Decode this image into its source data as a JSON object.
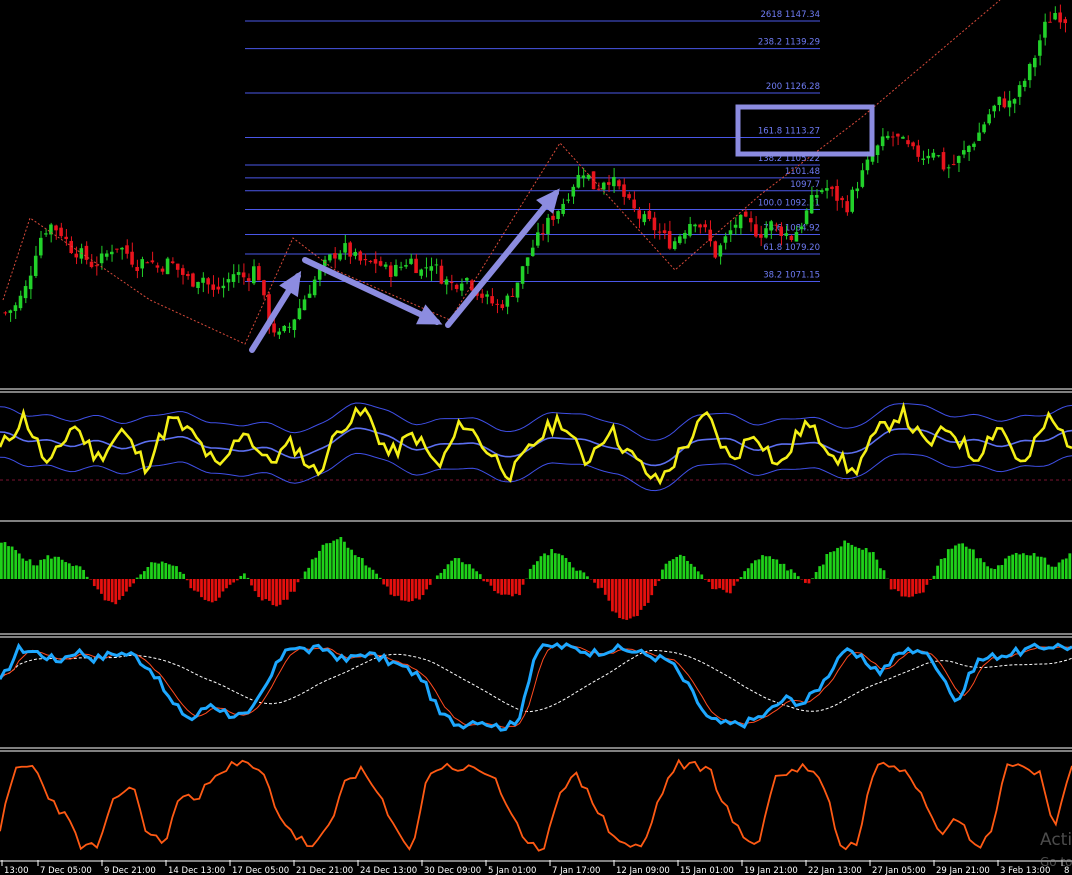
{
  "chart_data": [
    {
      "type": "candlestick",
      "symbol_context": "price with fibonacci retracement/extension levels",
      "fib_levels": [
        {
          "label": "2618 1147.34",
          "value": 1147.34
        },
        {
          "label": "238.2 1139.29",
          "value": 1139.29
        },
        {
          "label": "200 1126.28",
          "value": 1126.28
        },
        {
          "label": "161.8 1113.27",
          "value": 1113.27
        },
        {
          "label": "138.2 1105.22",
          "value": 1105.22
        },
        {
          "label": "1101.48",
          "value": 1101.48
        },
        {
          "label": "1097.7",
          "value": 1097.7
        },
        {
          "label": "100.0 1092.21",
          "value": 1092.21
        },
        {
          "label": "78.6 1084.92",
          "value": 1084.92
        },
        {
          "label": "61.8 1079.20",
          "value": 1079.2
        },
        {
          "label": "38.2 1071.15",
          "value": 1071.15
        }
      ],
      "close_trend": [
        1062,
        1064,
        1070,
        1083,
        1088,
        1086,
        1081,
        1079,
        1076,
        1078,
        1082,
        1080,
        1076,
        1078,
        1075,
        1077,
        1074,
        1071,
        1073,
        1068,
        1070,
        1074,
        1072,
        1076,
        1060,
        1055,
        1058,
        1064,
        1070,
        1075,
        1079,
        1081,
        1078,
        1076,
        1077,
        1074,
        1075,
        1078,
        1074,
        1077,
        1072,
        1070,
        1073,
        1069,
        1066,
        1064,
        1066,
        1072,
        1080,
        1085,
        1090,
        1094,
        1100,
        1104,
        1098,
        1102,
        1099,
        1094,
        1090,
        1088,
        1085,
        1082,
        1086,
        1090,
        1086,
        1079,
        1084,
        1089,
        1088,
        1085,
        1088,
        1086,
        1084,
        1089,
        1096,
        1099,
        1096,
        1093,
        1100,
        1106,
        1111,
        1114,
        1112,
        1109,
        1108,
        1110,
        1104,
        1106,
        1110,
        1114,
        1120,
        1124,
        1123,
        1128,
        1135,
        1145,
        1150,
        1148
      ]
    },
    {
      "type": "line",
      "name": "oscillator-1",
      "series": [
        {
          "values": [
            55,
            82,
            40,
            76,
            48,
            70,
            42,
            80,
            65,
            38,
            72,
            44,
            60,
            35,
            75,
            85,
            50,
            68,
            40,
            78,
            55,
            35,
            62,
            80,
            45,
            72,
            48,
            28,
            55,
            82,
            46,
            70,
            40,
            76,
            58,
            36,
            68,
            85,
            58,
            72,
            48,
            76,
            40,
            80,
            60
          ]
        }
      ]
    },
    {
      "type": "bar",
      "name": "histogram",
      "values": [
        0.8,
        0.6,
        0.3,
        0.5,
        0.4,
        0.2,
        -0.3,
        -0.6,
        -0.2,
        0.3,
        0.4,
        0.2,
        -0.3,
        -0.5,
        -0.2,
        0.1,
        -0.4,
        -0.6,
        -0.3,
        0.3,
        0.8,
        0.9,
        0.5,
        0.2,
        -0.3,
        -0.5,
        -0.4,
        0.1,
        0.5,
        0.3,
        -0.1,
        -0.4,
        -0.3,
        0.4,
        0.6,
        0.4,
        0.1,
        -0.2,
        -0.8,
        -0.9,
        -0.5,
        0.3,
        0.5,
        0.2,
        -0.2,
        -0.3,
        0.2,
        0.5,
        0.4,
        0.1,
        -0.1,
        0.5,
        0.8,
        0.7,
        0.5,
        -0.2,
        -0.4,
        -0.3,
        0.4,
        0.8,
        0.6,
        0.2,
        0.4,
        0.6,
        0.5,
        0.3,
        0.5
      ]
    },
    {
      "type": "line",
      "name": "stochastic",
      "series": [
        {
          "values": [
            60,
            92,
            88,
            80,
            90,
            82,
            88,
            86,
            70,
            40,
            25,
            40,
            30,
            28,
            60,
            95,
            90,
            92,
            80,
            88,
            82,
            75,
            65,
            30,
            20,
            25,
            18,
            20,
            90,
            95,
            92,
            88,
            92,
            90,
            85,
            80,
            55,
            25,
            20,
            22,
            30,
            45,
            40,
            60,
            90,
            82,
            70,
            88,
            92,
            75,
            40,
            80,
            85,
            88,
            92,
            95,
            93
          ]
        }
      ]
    },
    {
      "type": "line",
      "name": "oscillator-2",
      "series": [
        {
          "values": [
            30,
            88,
            90,
            60,
            40,
            10,
            12,
            60,
            72,
            22,
            15,
            65,
            55,
            85,
            90,
            92,
            80,
            40,
            20,
            10,
            30,
            80,
            85,
            60,
            25,
            10,
            85,
            90,
            88,
            86,
            80,
            40,
            10,
            12,
            70,
            80,
            55,
            25,
            12,
            10,
            60,
            92,
            90,
            88,
            50,
            20,
            15,
            80,
            85,
            90,
            70,
            10,
            15,
            90,
            92,
            88,
            60,
            25,
            45,
            10,
            20,
            92,
            90,
            85,
            30,
            88
          ]
        }
      ]
    }
  ],
  "time_axis": {
    "labels": [
      "13:00",
      "7 Dec 05:00",
      "9 Dec 21:00",
      "14 Dec 13:00",
      "17 Dec 05:00",
      "21 Dec 21:00",
      "24 Dec 13:00",
      "30 Dec 09:00",
      "5 Jan 01:00",
      "7 Jan 17:00",
      "12 Jan 09:00",
      "15 Jan 01:00",
      "19 Jan 21:00",
      "22 Jan 13:00",
      "27 Jan 05:00",
      "29 Jan 21:00",
      "3 Feb 13:00",
      "8"
    ]
  },
  "watermark": {
    "line1": "Acti",
    "line2": "Go to"
  },
  "colors": {
    "background": "#000000",
    "bull": "#22d12a",
    "bear": "#e8141d",
    "fib": "#4a57e8",
    "fib_text": "#6f7cf5",
    "zigzag": "#d84a3a",
    "arrow": "#8c8ce0",
    "osc_yellow": "#f4f017",
    "osc_band": "#3f4fe6",
    "osc_mid": "#5c6ff0",
    "hist_pos": "#1fd11a",
    "hist_neg": "#e5100e",
    "stoch_main": "#1ea8ff",
    "stoch_signal": "#ff4a1f",
    "stoch_ma": "#ffffff",
    "osc2": "#ff5a14",
    "panel_border": "#ffffff",
    "level_line": "#7a1230"
  }
}
